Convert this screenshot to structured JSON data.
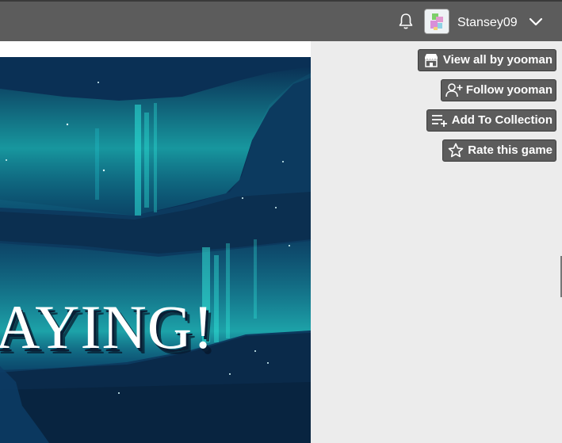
{
  "header": {
    "username": "Stansey09",
    "icons": {
      "notifications": "bell-icon",
      "menu": "chevron-down-icon",
      "avatar": "user-avatar"
    }
  },
  "cover": {
    "visible_title": "AYING!"
  },
  "actions": [
    {
      "label": "View all by yooman",
      "icon": "itchio-store-icon"
    },
    {
      "label": "Follow yooman",
      "icon": "user-plus-icon"
    },
    {
      "label": "Add To Collection",
      "icon": "playlist-add-icon"
    },
    {
      "label": "Rate this game",
      "icon": "star-outline-icon"
    }
  ],
  "colors": {
    "topbar": "#5c5c5c",
    "button": "#5c5c5c",
    "sidebar": "#ececec",
    "cover_base": "#0b3458",
    "aurora": "#1fd1c8"
  }
}
